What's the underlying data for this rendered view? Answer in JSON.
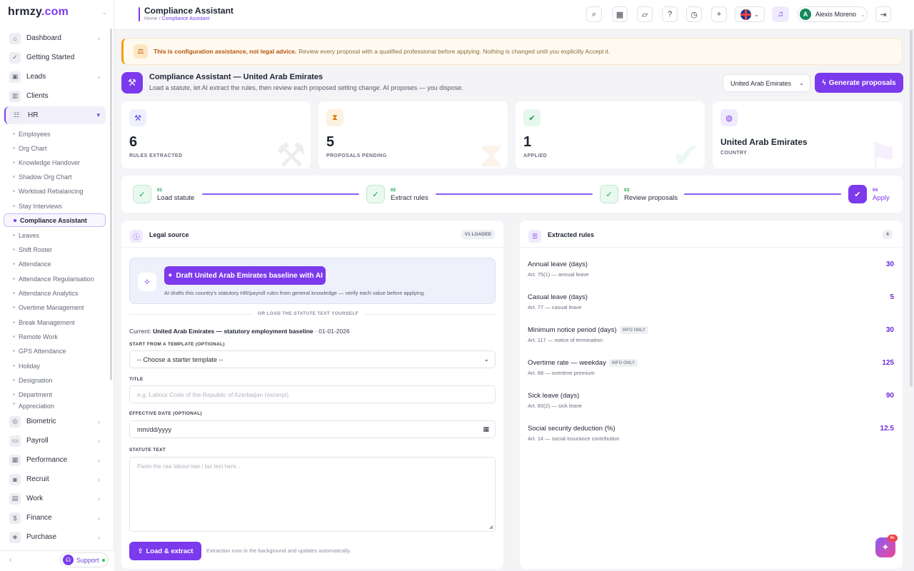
{
  "sidebar": {
    "logo": "hrmzy",
    "logo_dot": ".com",
    "items": [
      {
        "label": "Dashboard",
        "icon": "home-icon",
        "arrow": true
      },
      {
        "label": "Getting Started",
        "icon": "check-circle-icon",
        "arrow": false
      },
      {
        "label": "Leads",
        "icon": "id-card-icon",
        "arrow": true
      },
      {
        "label": "Clients",
        "icon": "chart-icon",
        "arrow": false
      },
      {
        "label": "HR",
        "icon": "people-icon",
        "arrow": true
      }
    ],
    "hr_sub": [
      "Employees",
      "Org Chart",
      "Knowledge Handover",
      "Shadow Org Chart",
      "Workload Rebalancing",
      "Stay Interviews",
      "Compliance Assistant",
      "Leaves",
      "Shift Roster",
      "Attendance",
      "Attendance Regularisation",
      "Attendance Analytics",
      "Overtime Management",
      "Break Management",
      "Remote Work",
      "GPS Attendance",
      "Holiday",
      "Designation",
      "Department",
      "Appreciation"
    ],
    "lower_items": [
      {
        "label": "Biometric",
        "icon": "fingerprint-icon"
      },
      {
        "label": "Payroll",
        "icon": "wallet-icon"
      },
      {
        "label": "Performance",
        "icon": "bar-chart-icon"
      },
      {
        "label": "Recruit",
        "icon": "recruit-icon"
      },
      {
        "label": "Work",
        "icon": "briefcase-icon"
      },
      {
        "label": "Finance",
        "icon": "dollar-icon"
      },
      {
        "label": "Purchase",
        "icon": "layers-icon"
      }
    ],
    "support": "Support"
  },
  "topbar": {
    "title": "Compliance Assistant",
    "crumb_home": "Home",
    "crumb_sep": "/",
    "crumb_current": "Compliance Assistant",
    "user_initial": "A",
    "user_name": "Alexis Moreno"
  },
  "banner": {
    "bold": "This is configuration assistance, not legal advice.",
    "text": "Review every proposal with a qualified professional before applying. Nothing is changed until you explicitly Accept it."
  },
  "header": {
    "title": "Compliance Assistant — United Arab Emirates",
    "subtitle": "Load a statute, let AI extract the rules, then review each proposed setting change. AI proposes — you dispose.",
    "country_select": "United Arab Emirates",
    "generate_label": "Generate proposals"
  },
  "stats": [
    {
      "value": "6",
      "label": "RULES EXTRACTED"
    },
    {
      "value": "5",
      "label": "PROPOSALS PENDING"
    },
    {
      "value": "1",
      "label": "APPLIED"
    },
    {
      "value": "United Arab Emirates",
      "label": "COUNTRY"
    }
  ],
  "steps": [
    {
      "num": "01",
      "label": "Load statute"
    },
    {
      "num": "02",
      "label": "Extract rules"
    },
    {
      "num": "03",
      "label": "Review proposals"
    },
    {
      "num": "04",
      "label": "Apply"
    }
  ],
  "legal": {
    "title": "Legal source",
    "badge": "V1 LOADED",
    "ai_button": "Draft United Arab Emirates baseline with AI",
    "ai_note": "AI drafts this country's statutory HR/payroll rules from general knowledge — verify each value before applying.",
    "or_text": "OR LOAD THE STATUTE TEXT YOURSELF",
    "current_prefix": "Current:",
    "current_name": "United Arab Emirates — statutory employment baseline",
    "current_date": "· 01-01-2026",
    "template_label": "START FROM A TEMPLATE (OPTIONAL)",
    "template_value": "-- Choose a starter template --",
    "title_label": "TITLE",
    "title_placeholder": "e.g. Labour Code of the Republic of Azerbaijan (excerpt)",
    "date_label": "EFFECTIVE DATE (OPTIONAL)",
    "date_placeholder": "mm/dd/yyyy",
    "statute_label": "STATUTE TEXT",
    "statute_placeholder": "Paste the raw labour-law / tax text here...",
    "load_button": "Load & extract",
    "load_note": "Extraction runs in the background and updates automatically."
  },
  "rules": {
    "title": "Extracted rules",
    "count": "6",
    "items": [
      {
        "name": "Annual leave (days)",
        "ref": "Art. 75(1) — annual leave",
        "value": "30",
        "tag": ""
      },
      {
        "name": "Casual leave (days)",
        "ref": "Art. 77 — casual leave",
        "value": "5",
        "tag": ""
      },
      {
        "name": "Minimum notice period (days)",
        "ref": "Art. 117 — notice of termination",
        "value": "30",
        "tag": "INFO ONLY"
      },
      {
        "name": "Overtime rate — weekday",
        "ref": "Art. 68 — overtime premium",
        "value": "125",
        "tag": "INFO ONLY"
      },
      {
        "name": "Sick leave (days)",
        "ref": "Art. 83(2) — sick leave",
        "value": "90",
        "tag": ""
      },
      {
        "name": "Social security deduction (%)",
        "ref": "Art. 14 — social insurance contribution",
        "value": "12.5",
        "tag": ""
      }
    ]
  },
  "fab_badge": "9+",
  "colors": {
    "accent": "#7c3aed",
    "success": "#16a34a",
    "warning": "#f59e0b"
  }
}
